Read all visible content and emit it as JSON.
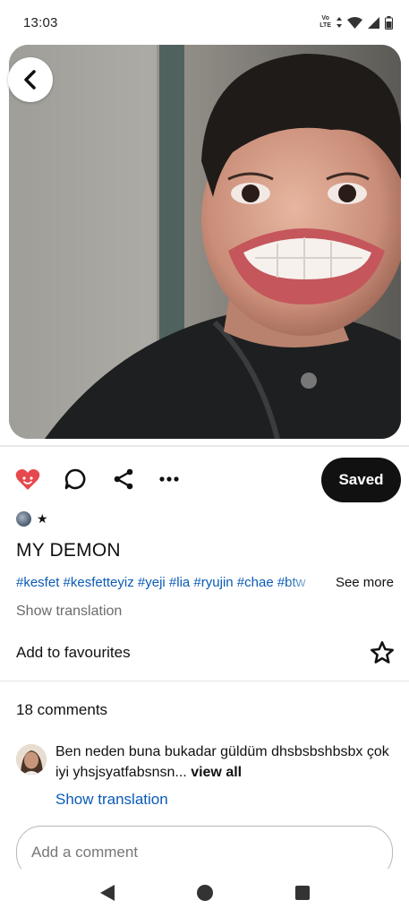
{
  "status_bar": {
    "time": "13:03",
    "network_label_top": "Vo",
    "network_label_bottom": "LTE",
    "icons": [
      "volte-icon",
      "data-arrows-icon",
      "wifi-icon",
      "signal-icon",
      "battery-icon"
    ]
  },
  "pin": {
    "image_alt": "pin-image",
    "back_icon": "chevron-left-icon"
  },
  "actions": {
    "icons": [
      "heart-icon",
      "comment-icon",
      "share-icon",
      "more-icon"
    ],
    "saved_label": "Saved",
    "heart_color": "#e60023"
  },
  "creator": {
    "badge": "★"
  },
  "title": "MY DEMON",
  "hashtags": "#kesfet #kesfetteyiz #yeji #lia #ryujin #chae #btw",
  "see_more": "See more",
  "show_translation": "Show translation",
  "favourites": {
    "label": "Add to favourites",
    "icon": "star-outline-icon"
  },
  "comments": {
    "count_label": "18 comments",
    "items": [
      {
        "text": "Ben neden buna bukadar güldüm dhsbsbshbsbx çok iyi yhsjsyatfabsnsn...",
        "view_all": "view all",
        "show_translation": "Show translation"
      }
    ],
    "input_placeholder": "Add a comment"
  },
  "nav": {
    "icons": [
      "back-triangle-icon",
      "home-circle-icon",
      "recents-square-icon"
    ]
  },
  "colors": {
    "link_blue": "#0a5bb5",
    "saved_bg": "#111111"
  }
}
